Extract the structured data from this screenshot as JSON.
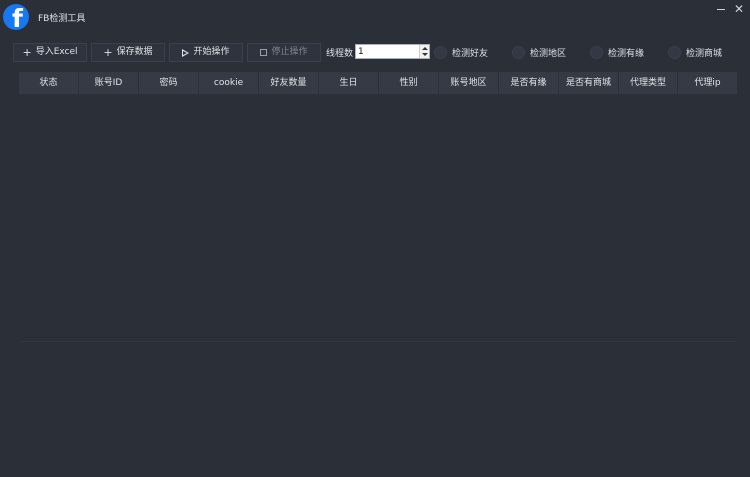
{
  "app": {
    "title": "FB检测工具",
    "logo_letter": "f",
    "brand_color": "#1877f2"
  },
  "window_controls": {
    "minimize_icon": "minimize-icon",
    "close_label": "✕"
  },
  "toolbar": {
    "import_label": "导入Excel",
    "save_label": "保存数据",
    "start_label": "开始操作",
    "stop_label": "停止操作",
    "thread_label": "线程数",
    "thread_value": "1"
  },
  "options": [
    {
      "label": "检测好友"
    },
    {
      "label": "检测地区"
    },
    {
      "label": "检测有缘"
    },
    {
      "label": "检测商城"
    }
  ],
  "table": {
    "columns": [
      "状态",
      "账号ID",
      "密码",
      "cookie",
      "好友数量",
      "生日",
      "性别",
      "账号地区",
      "是否有缘",
      "是否有商城",
      "代理类型",
      "代理ip"
    ],
    "rows": []
  }
}
